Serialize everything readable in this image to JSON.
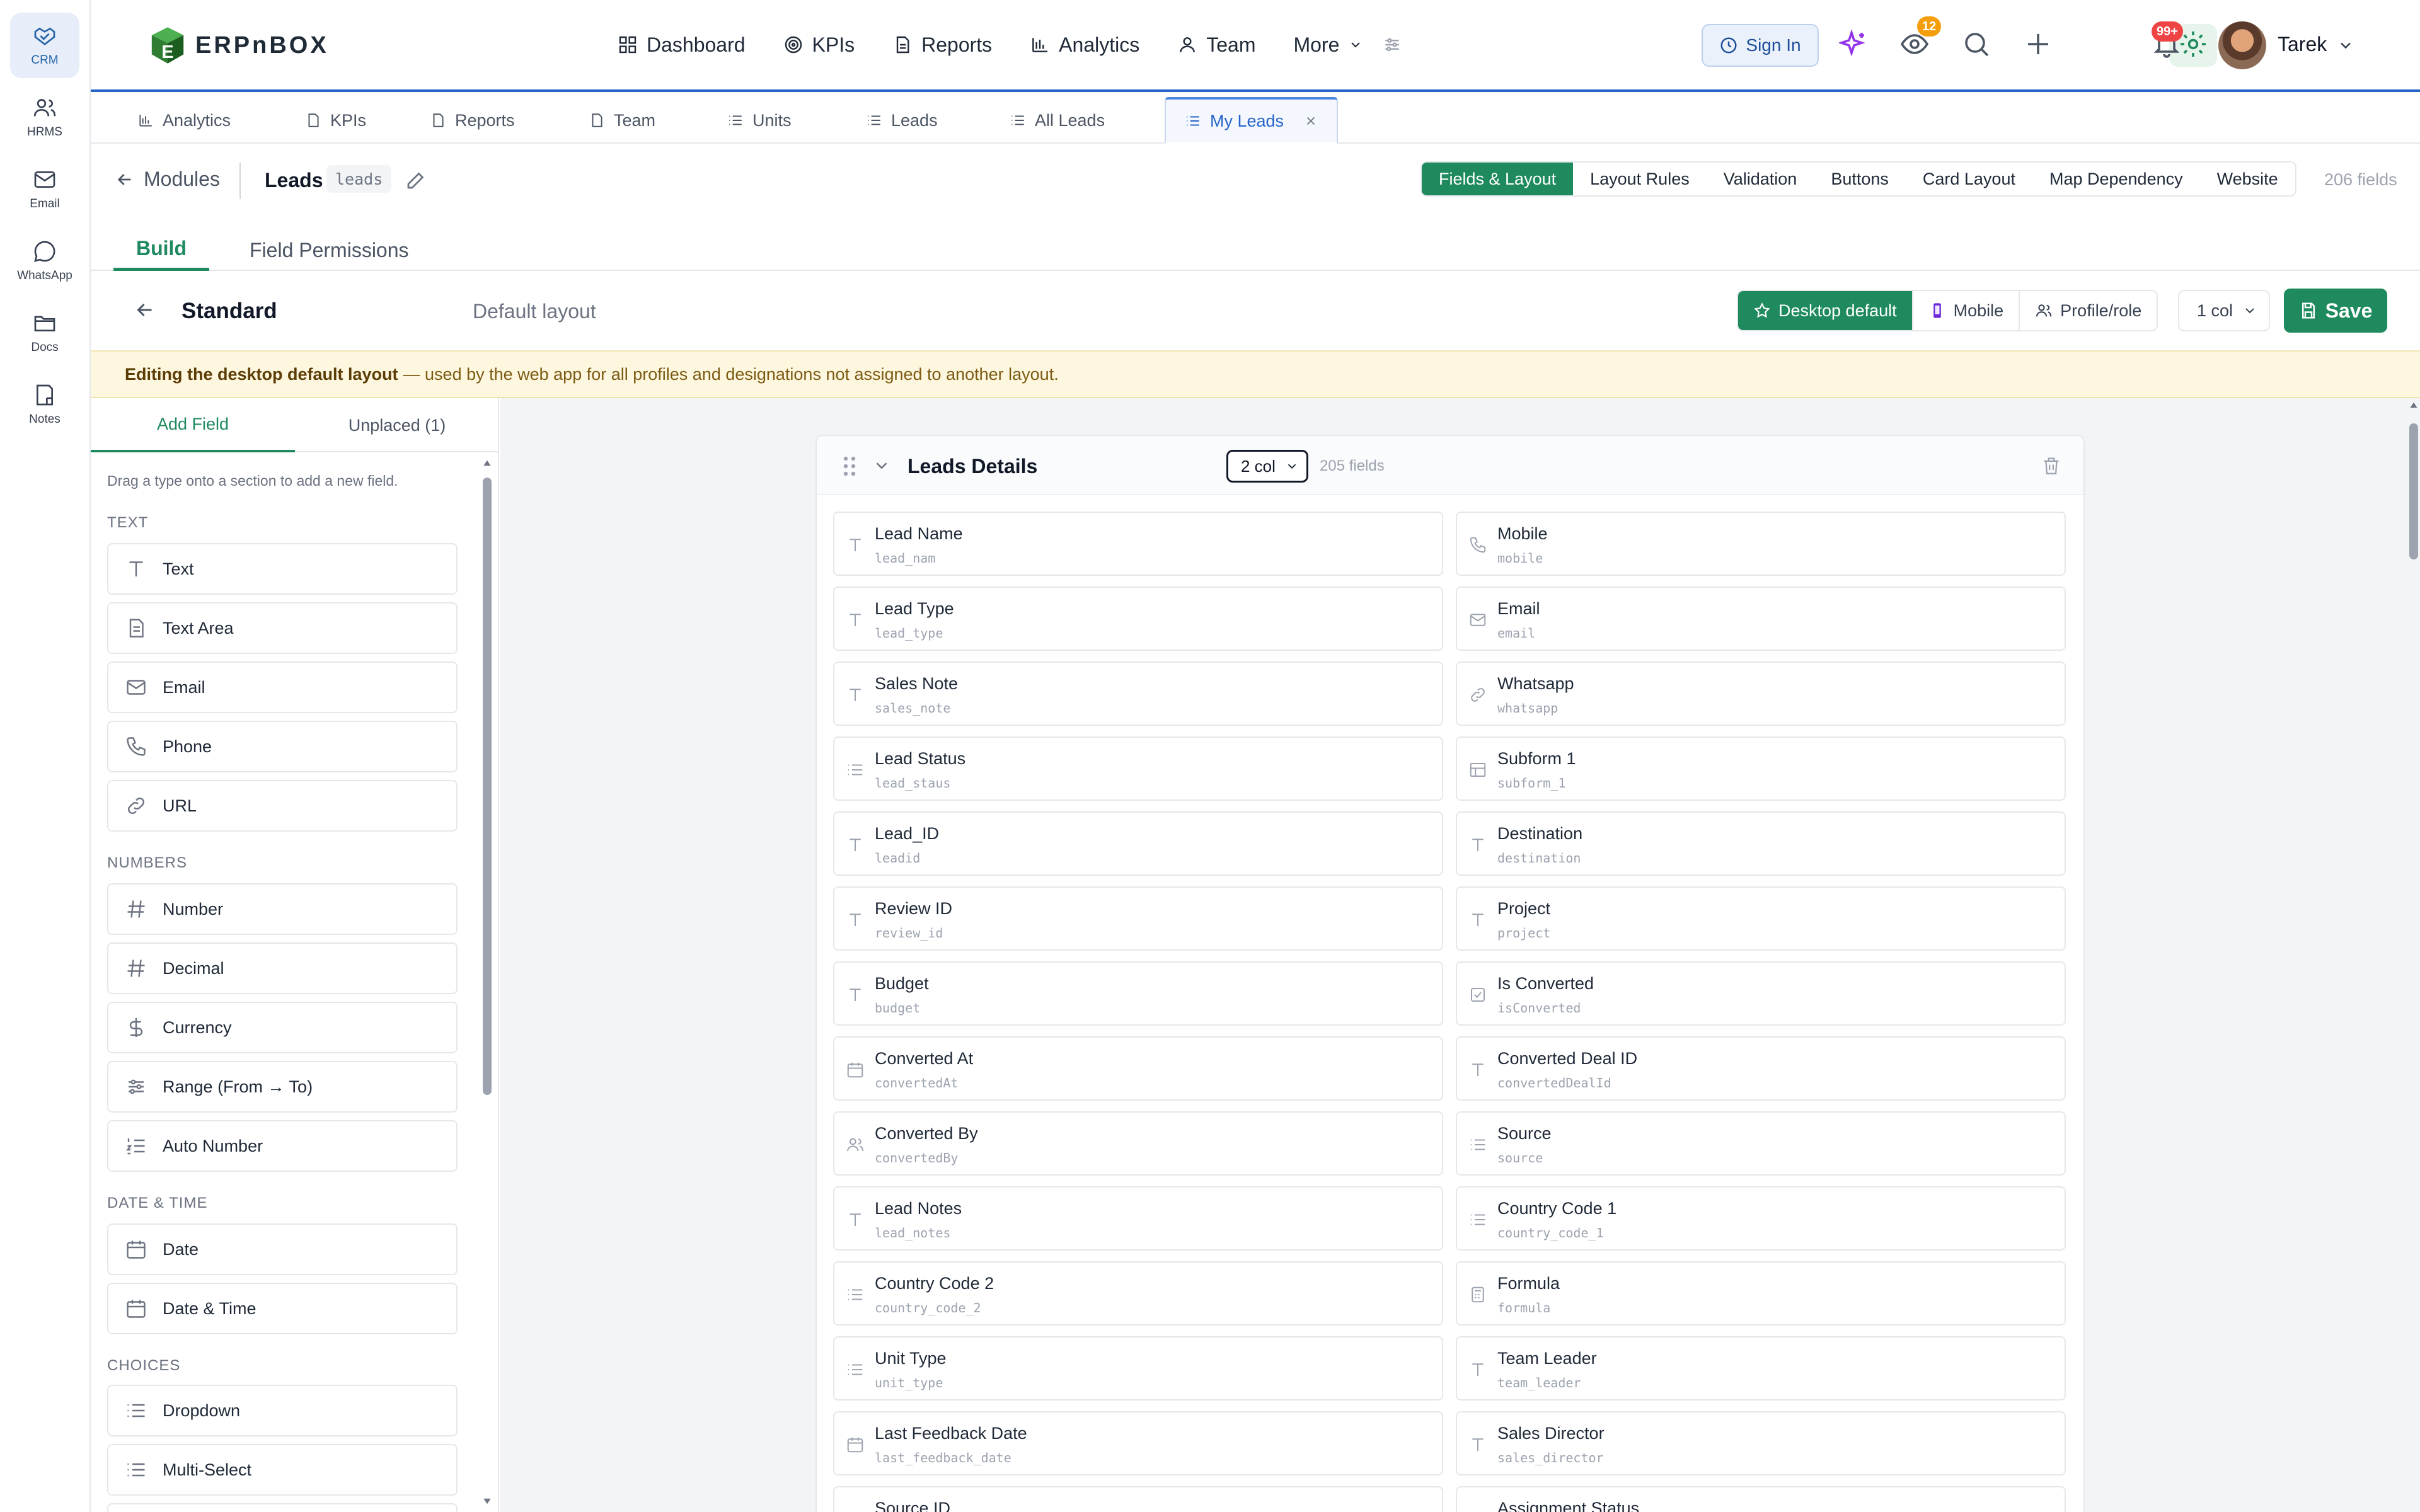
{
  "rail": [
    {
      "label": "CRM",
      "icon": "handshake-icon"
    },
    {
      "label": "HRMS",
      "icon": "users-icon"
    },
    {
      "label": "Email",
      "icon": "mail-icon"
    },
    {
      "label": "WhatsApp",
      "icon": "chat-bubble-icon"
    },
    {
      "label": "Docs",
      "icon": "folder-icon"
    },
    {
      "label": "Notes",
      "icon": "note-icon"
    }
  ],
  "brand": {
    "name": "ERPnBOX"
  },
  "nav": [
    {
      "label": "Dashboard",
      "icon": "grid-icon"
    },
    {
      "label": "KPIs",
      "icon": "target-icon"
    },
    {
      "label": "Reports",
      "icon": "document-icon"
    },
    {
      "label": "Analytics",
      "icon": "bar-chart-icon"
    },
    {
      "label": "Team",
      "icon": "user-icon"
    },
    {
      "label": "More",
      "icon": "chevron-down-icon"
    }
  ],
  "topbar": {
    "sign_in": "Sign In",
    "watch_badge": "12",
    "notif_badge": "99+",
    "user": "Tarek"
  },
  "tabs": [
    {
      "label": "Analytics"
    },
    {
      "label": "KPIs"
    },
    {
      "label": "Reports"
    },
    {
      "label": "Team"
    },
    {
      "label": "Units"
    },
    {
      "label": "Leads"
    },
    {
      "label": "All Leads"
    },
    {
      "label": "My Leads"
    }
  ],
  "module": {
    "back": "Modules",
    "name": "Leads",
    "slug": "leads",
    "segments": [
      "Fields & Layout",
      "Layout Rules",
      "Validation",
      "Buttons",
      "Card Layout",
      "Map Dependency",
      "Website"
    ],
    "fields_count": "206 fields"
  },
  "build_tabs": [
    "Build",
    "Field Permissions"
  ],
  "layout": {
    "title": "Standard",
    "subtitle": "Default layout",
    "modes": [
      "Desktop default",
      "Mobile",
      "Profile/role"
    ],
    "cols": "1 col",
    "save": "Save"
  },
  "notice": {
    "bold": "Editing the desktop default layout",
    "rest": "— used by the web app for all profiles and designations not assigned to another layout."
  },
  "side": {
    "tabs": [
      "Add Field",
      "Unplaced (1)"
    ],
    "hint": "Drag a type onto a section to add a new field.",
    "groups": [
      {
        "label": "TEXT",
        "items": [
          "Text",
          "Text Area",
          "Email",
          "Phone",
          "URL"
        ]
      },
      {
        "label": "NUMBERS",
        "items": [
          "Number",
          "Decimal",
          "Currency",
          "Range (From → To)",
          "Auto Number"
        ]
      },
      {
        "label": "DATE & TIME",
        "items": [
          "Date",
          "Date & Time"
        ]
      },
      {
        "label": "CHOICES",
        "items": [
          "Dropdown",
          "Multi-Select"
        ]
      }
    ]
  },
  "section": {
    "title": "Leads Details",
    "cols": "2 col",
    "count": "205 fields",
    "fields": [
      {
        "label": "Lead Name",
        "key": "lead_nam",
        "icon": "text"
      },
      {
        "label": "Mobile",
        "key": "mobile",
        "icon": "phone"
      },
      {
        "label": "Lead Type",
        "key": "lead_type",
        "icon": "text"
      },
      {
        "label": "Email",
        "key": "email",
        "icon": "mail"
      },
      {
        "label": "Sales Note",
        "key": "sales_note",
        "icon": "text"
      },
      {
        "label": "Whatsapp",
        "key": "whatsapp",
        "icon": "link"
      },
      {
        "label": "Lead Status",
        "key": "lead_staus",
        "icon": "list"
      },
      {
        "label": "Subform 1",
        "key": "subform_1",
        "icon": "table"
      },
      {
        "label": "Lead_ID",
        "key": "leadid",
        "icon": "text"
      },
      {
        "label": "Destination",
        "key": "destination",
        "icon": "text"
      },
      {
        "label": "Review ID",
        "key": "review_id",
        "icon": "text"
      },
      {
        "label": "Project",
        "key": "project",
        "icon": "text"
      },
      {
        "label": "Budget",
        "key": "budget",
        "icon": "text"
      },
      {
        "label": "Is Converted",
        "key": "isConverted",
        "icon": "check"
      },
      {
        "label": "Converted At",
        "key": "convertedAt",
        "icon": "calendar"
      },
      {
        "label": "Converted Deal ID",
        "key": "convertedDealId",
        "icon": "text"
      },
      {
        "label": "Converted By",
        "key": "convertedBy",
        "icon": "users"
      },
      {
        "label": "Source",
        "key": "source",
        "icon": "list"
      },
      {
        "label": "Lead Notes",
        "key": "lead_notes",
        "icon": "text"
      },
      {
        "label": "Country Code 1",
        "key": "country_code_1",
        "icon": "list"
      },
      {
        "label": "Country Code 2",
        "key": "country_code_2",
        "icon": "list"
      },
      {
        "label": "Formula",
        "key": "formula",
        "icon": "calc"
      },
      {
        "label": "Unit Type",
        "key": "unit_type",
        "icon": "list"
      },
      {
        "label": "Team Leader",
        "key": "team_leader",
        "icon": "text"
      },
      {
        "label": "Last Feedback Date",
        "key": "last_feedback_date",
        "icon": "calendar"
      },
      {
        "label": "Sales Director",
        "key": "sales_director",
        "icon": "text"
      },
      {
        "label": "Source ID",
        "key": "",
        "icon": "text"
      },
      {
        "label": "Assignment Status",
        "key": "",
        "icon": "list"
      }
    ]
  },
  "colors": {
    "accent": "#1e8a5e",
    "brand_blue": "#2563c9",
    "notice_bg": "#fdf7df"
  }
}
